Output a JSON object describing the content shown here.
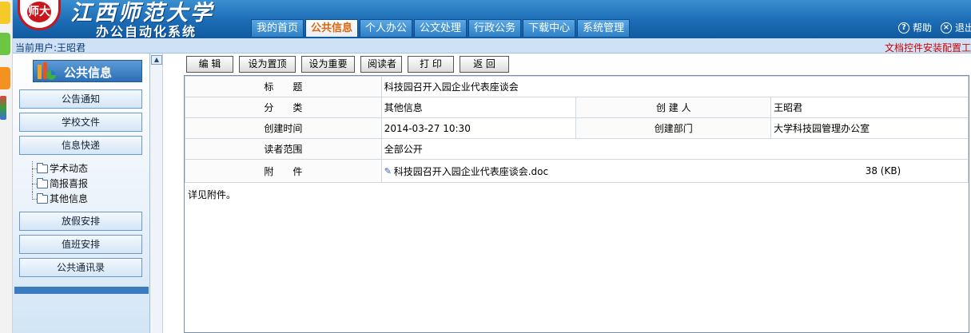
{
  "header": {
    "university_name": "江西师范大学",
    "system_name": "办公自动化系统",
    "logo_text": "师大",
    "nav_tabs": [
      {
        "label": "我的首页",
        "active": false
      },
      {
        "label": "公共信息",
        "active": true
      },
      {
        "label": "个人办公",
        "active": false
      },
      {
        "label": "公文处理",
        "active": false
      },
      {
        "label": "行政公务",
        "active": false
      },
      {
        "label": "下载中心",
        "active": false
      },
      {
        "label": "系统管理",
        "active": false
      }
    ],
    "help_label": "帮助",
    "exit_label": "退出"
  },
  "status_bar": {
    "current_user": "当前用户:王昭君",
    "right_notice": "文档控件安装配置工"
  },
  "sidebar": {
    "title": "公共信息",
    "buttons_top": [
      "公告通知",
      "学校文件",
      "信息快递"
    ],
    "tree_items": [
      "学术动态",
      "简报喜报",
      "其他信息"
    ],
    "buttons_bottom": [
      "放假安排",
      "值班安排",
      "公共通讯录"
    ]
  },
  "toolbar": {
    "buttons": [
      "编 辑",
      "设为置顶",
      "设为重要",
      "阅读者",
      "打 印",
      "返 回"
    ]
  },
  "detail": {
    "title_label": "标　　题",
    "title_value": "科技园召开入园企业代表座谈会",
    "category_label": "分　　类",
    "category_value": "其他信息",
    "creator_label": "创 建 人",
    "creator_value": "王昭君",
    "created_time_label": "创建时间",
    "created_time_value": "2014-03-27 10:30",
    "dept_label": "创建部门",
    "dept_value": "大学科技园管理办公室",
    "readers_label": "读者范围",
    "readers_value": "全部公开",
    "attachment_label": "附　　件",
    "attachment_name": "科技园召开入园企业代表座谈会.doc",
    "attachment_size": "38 (KB)",
    "body": "详见附件。"
  },
  "colors": {
    "header_blue": "#1c6cb5",
    "active_tab_text": "#e0650a",
    "notice_red": "#cc0000"
  }
}
